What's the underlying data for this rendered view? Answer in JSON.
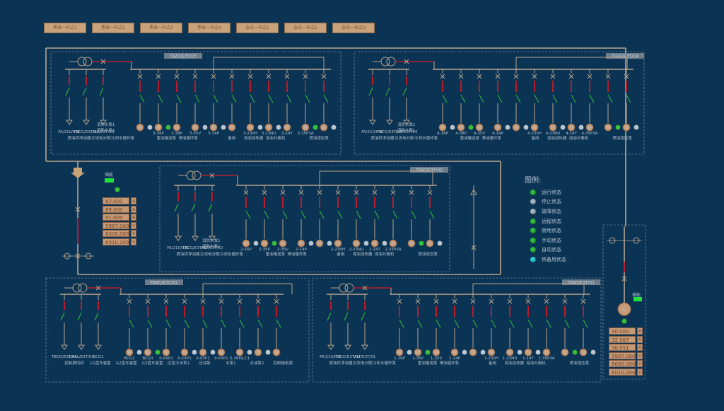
{
  "tabs": [
    "票表一样式1",
    "票表一样式2",
    "票表一样式3",
    "票表一样式4",
    "自天一样式1",
    "自天一样式2",
    "自天一样式3"
  ],
  "sections": {
    "s1": {
      "title": "TBAT/E3T/03"
    },
    "s2": {
      "title": "TBAT/E3T/04"
    },
    "s3": {
      "title": "TBAT/E3T/02"
    },
    "s4": {
      "title": "TBAC/E3C/01"
    },
    "s5": {
      "title": "TBAT/E3T/01"
    }
  },
  "notes": {
    "fire_pump": "消防水泵1"
  },
  "left_panel": {
    "label": "储能",
    "values": [
      {
        "value": "87.000",
        "unit": "A"
      },
      {
        "value": "89.000",
        "unit": "A"
      },
      {
        "value": "91.000",
        "unit": "A"
      },
      {
        "value": "5997.000",
        "unit": "V"
      },
      {
        "value": "6000.000",
        "unit": "V"
      },
      {
        "value": "6010.200",
        "unit": "V"
      }
    ]
  },
  "right_panel": {
    "label": "储能",
    "eg": "EG",
    "values": [
      {
        "value": "30.000",
        "unit": "A"
      },
      {
        "value": "32.567",
        "unit": "A"
      },
      {
        "value": "30.051",
        "unit": "A"
      },
      {
        "value": "5997.000",
        "unit": "V"
      },
      {
        "value": "6000.000",
        "unit": "V"
      },
      {
        "value": "6010.200",
        "unit": "V"
      }
    ]
  },
  "legend": {
    "title": "图例:",
    "items": [
      {
        "label": "运行状态",
        "color": "#2ec23a"
      },
      {
        "label": "停止状态",
        "color": "#aab8c4"
      },
      {
        "label": "故障状态",
        "color": "#aab8c4"
      },
      {
        "label": "远程状态",
        "color": "#2ec23a"
      },
      {
        "label": "就地状态",
        "color": "#2ec23a"
      },
      {
        "label": "手动状态",
        "color": "#2ec23a"
      },
      {
        "label": "自动状态",
        "color": "#2ec23a"
      },
      {
        "label": "热备用状态",
        "color": "#2ad0d8"
      }
    ]
  },
  "labels": {
    "s1": [
      "燃油供净油器",
      "交流电分配",
      "冷却水循环泵",
      "",
      "重油输送泵",
      "滑油循环泵",
      "",
      "备用",
      "海油加热器",
      "海油分离机",
      "",
      "燃油增压泵"
    ],
    "s1_codes": [
      "FA/210/03C",
      "TBCG/E3T/03",
      "ALT/E3T/03",
      "",
      "3-36P",
      "3-38P",
      "3-35V",
      "3-14P",
      "",
      "3-230H",
      "3-23NU",
      "3-14T",
      "3-35P3A"
    ],
    "s2": [
      "燃油供净油器",
      "交流电分配",
      "冷却水循环泵",
      "",
      "重油输送泵",
      "滑油循环泵",
      "",
      "备用",
      "海油加热器",
      "海油分离机",
      "",
      "燃油增压泵"
    ],
    "s2_codes": [
      "FA/210/04C",
      "TBCG/E3T/04",
      "ALT/E3T/04",
      "4-16P",
      "4-38P",
      "4-35V",
      "4-14P",
      "",
      "4-230H",
      "4-23NU",
      "4-14T",
      "4-35P3A"
    ],
    "s3": [
      "燃油供净油器",
      "交流电分配",
      "冷却水循环泵",
      "",
      "重油输送泵",
      "滑油循环泵",
      "",
      "备用",
      "海油加热器",
      "海油分离机",
      "",
      "燃油增压泵"
    ],
    "s3_codes": [
      "FA/210/02C",
      "TBCG/E3T/02",
      "ALT/E3T/02",
      "2-16P",
      "2-35P",
      "2-35V",
      "2-14P",
      "",
      "2-230H",
      "2-23NU",
      "2-14T",
      "2-35P3A"
    ],
    "s4": [
      "控制屏风机",
      "G1盘车装置",
      "G2盘车装置",
      "G3盘车装置",
      "应急冷水泵1",
      "压油泵",
      "水泵1",
      "水油泵2",
      "控制箱电源"
    ],
    "s4_codes": [
      "TBCD/E3T/01",
      "CAAL/E3T/01",
      "BCG1",
      "BCG2",
      "BCG3",
      "0-XXP1",
      "0-XXP1",
      "0-XXP1",
      "0-XXP1",
      "0-38P/LC1"
    ],
    "s5": [
      "燃油供净油器",
      "交流电分配",
      "冷却水循环泵",
      "",
      "重油输送泵",
      "滑油循环泵",
      "",
      "备用",
      "海油加热器",
      "海油分离机",
      "",
      "燃油增压泵"
    ],
    "s5_codes": [
      "FA/210/01C",
      "TBCG/E3T/01",
      "ALT/E3T/01",
      "1-16P",
      "1-35P",
      "1-35V",
      "1-14P",
      "",
      "1-230H",
      "1-23NU",
      "1-14T",
      "1-35P3A"
    ]
  }
}
